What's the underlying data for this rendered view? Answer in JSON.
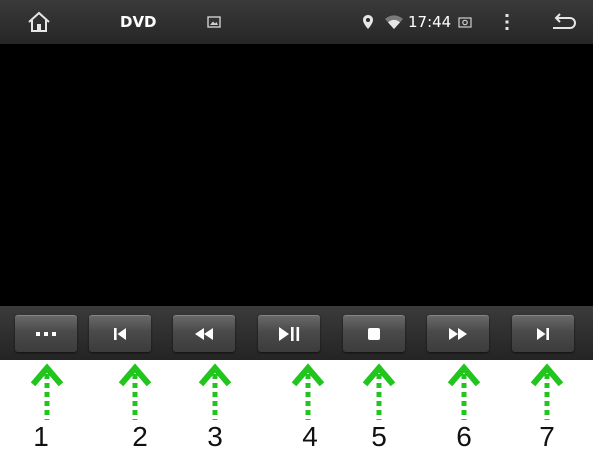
{
  "status_bar": {
    "home_icon": "home-icon",
    "title": "DVD",
    "gallery_icon": "image-icon",
    "location_icon": "location-pin-icon",
    "wifi_icon": "wifi-icon",
    "time": "17:44",
    "screenshot_icon": "screenshot-icon",
    "menu_icon": "overflow-menu-icon",
    "back_icon": "back-arrow-icon"
  },
  "controls": [
    {
      "action": "more",
      "icon": "more-dots-icon"
    },
    {
      "action": "previous",
      "icon": "skip-previous-icon"
    },
    {
      "action": "rewind",
      "icon": "rewind-icon"
    },
    {
      "action": "play-pause",
      "icon": "play-pause-icon"
    },
    {
      "action": "stop",
      "icon": "stop-icon"
    },
    {
      "action": "fast-forward",
      "icon": "fast-forward-icon"
    },
    {
      "action": "next",
      "icon": "skip-next-icon"
    }
  ],
  "callouts": [
    "1",
    "2",
    "3",
    "4",
    "5",
    "6",
    "7"
  ],
  "colors": {
    "callout_arrow": "#22c41e",
    "bar_background": "#2e2e2e",
    "video_background": "#000000"
  }
}
